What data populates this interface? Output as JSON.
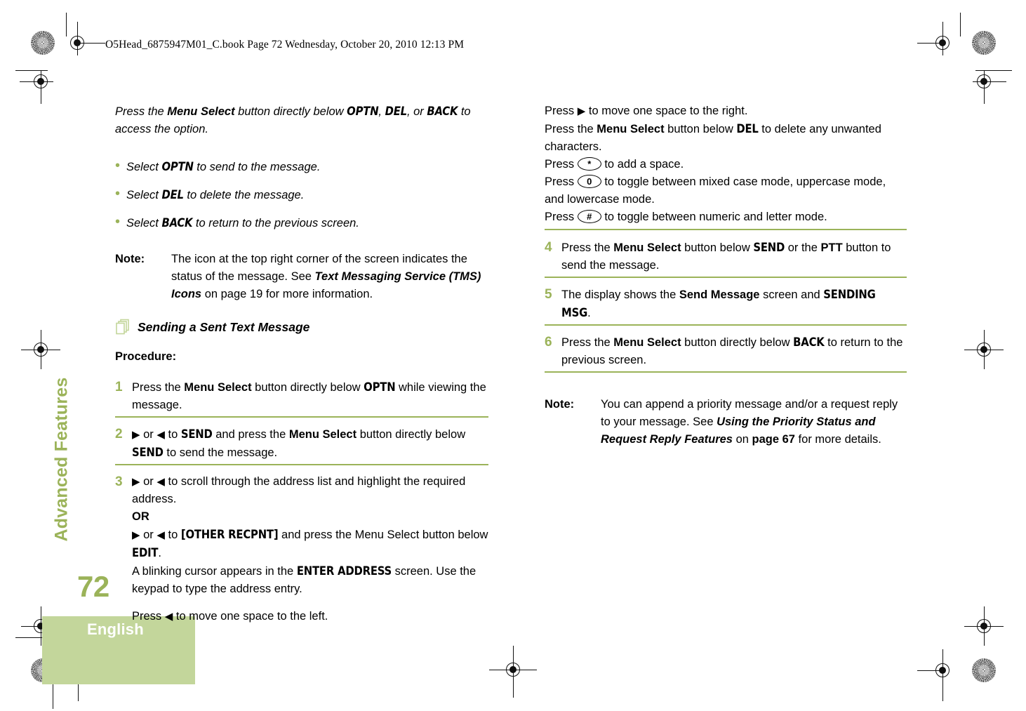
{
  "header": {
    "slug": "O5Head_6875947M01_C.book  Page 72  Wednesday, October 20, 2010  12:13 PM"
  },
  "sidebar": {
    "chapter": "Advanced Features",
    "page_number": "72",
    "language_tab": "English"
  },
  "colors": {
    "accent_green": "#9bb359",
    "tab_green": "#c3d69b",
    "rule_green": "#9bb359"
  },
  "left_column": {
    "intro": {
      "lead": "Press the ",
      "lead_bold": "Menu Select",
      "lead_2": " button directly below ",
      "lcd_1": "OPTN",
      "lead_3": ", ",
      "lcd_2": "DEL",
      "lead_4": ", or ",
      "lcd_3": "BACK",
      "lead_5": " to access the option."
    },
    "bullets": [
      {
        "pre": "Select ",
        "lcd": "OPTN",
        "post": " to send to the message."
      },
      {
        "pre": "Select ",
        "lcd": "DEL",
        "post": " to delete the message."
      },
      {
        "pre": "Select ",
        "lcd": "BACK",
        "post": " to return to the previous screen."
      }
    ],
    "note": {
      "label": "Note:",
      "part1": "The icon at the top right corner of the screen indicates the status of the message. See ",
      "bold_italic": "Text Messaging Service (TMS) Icons",
      "part2": " on page 19 for more information."
    },
    "section": {
      "icon": "stacked-pages-icon",
      "title": "Sending a Sent Text Message"
    },
    "procedure_label": "Procedure:",
    "steps": [
      {
        "num": "1",
        "t1": "Press the ",
        "b1": "Menu Select",
        "t2": " button directly below ",
        "lcd1": "OPTN",
        "t3": " while viewing the message."
      },
      {
        "num": "2",
        "arrow_right": "▶",
        "t1": " or ",
        "arrow_left": "◀",
        "t2": " to ",
        "lcd1": "SEND",
        "t3": " and press the ",
        "b1": "Menu Select",
        "t4": " button directly below ",
        "lcd2": "SEND",
        "t5": " to send the message."
      },
      {
        "num": "3",
        "arrow_right": "▶",
        "t1": " or ",
        "arrow_left": "◀",
        "t2": " to scroll through the address list and highlight the required address.",
        "or": "OR",
        "t3": " or ",
        "t4": " to ",
        "lcd1": "[OTHER RECPNT]",
        "t5": " and press the Menu Select button below ",
        "lcd2": "EDIT",
        "t6": ".",
        "t7": "A blinking cursor appears in the ",
        "lcd3": "ENTER ADDRESS",
        "t8": " screen. Use the keypad to type the address entry.",
        "t9": "Press ",
        "t10": " to move one space to the left."
      }
    ]
  },
  "right_column": {
    "step3_continued": {
      "l1_pre": "Press ",
      "l1_arrow": "▶",
      "l1_post": " to move one space to the right.",
      "l2_pre": "Press the ",
      "l2_bold": "Menu Select",
      "l2_mid": " button below ",
      "l2_lcd": "DEL",
      "l2_post": " to delete any unwanted characters.",
      "l3_pre": "Press ",
      "l3_key": "*",
      "l3_post": " to add a space.",
      "l4_pre": "Press ",
      "l4_key": "0",
      "l4_post": " to toggle between mixed case mode, uppercase mode, and lowercase mode.",
      "l5_pre": "Press ",
      "l5_key": "#",
      "l5_post": " to toggle between numeric and letter mode."
    },
    "steps": [
      {
        "num": "4",
        "t1": "Press the ",
        "b1": "Menu Select",
        "t2": " button below ",
        "lcd1": "SEND",
        "t3": " or the ",
        "b2": "PTT",
        "t4": " button to send the message."
      },
      {
        "num": "5",
        "t1": "The display shows the ",
        "b1": "Send Message",
        "t2": " screen and ",
        "lcd1": "SENDING MSG",
        "t3": "."
      },
      {
        "num": "6",
        "t1": "Press the ",
        "b1": "Menu Select",
        "t2": " button directly below ",
        "lcd1": "BACK",
        "t3": " to return to the previous screen."
      }
    ],
    "note": {
      "label": "Note:",
      "part1": "You can append a priority message and/or a request reply to your message. See ",
      "bold_italic": "Using the Priority Status and Request Reply Features",
      "part2": " on ",
      "bold_page": "page 67",
      "part3": " for more details."
    }
  }
}
